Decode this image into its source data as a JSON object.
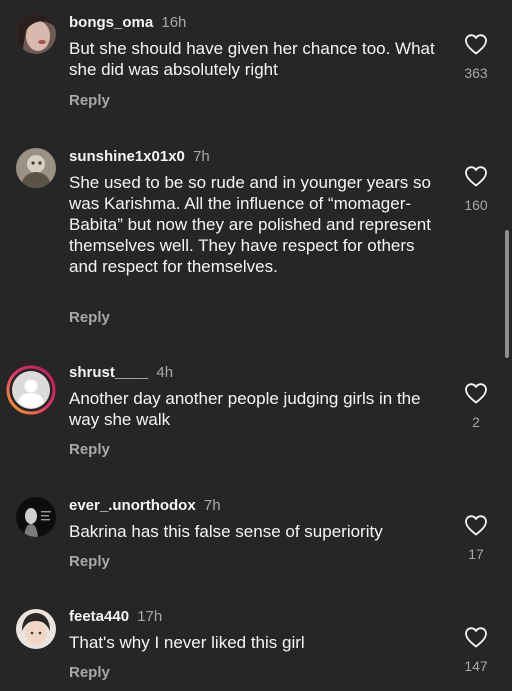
{
  "comments": [
    {
      "username": "bongs_oma",
      "time": "16h",
      "text": "But she should have given her chance too. What she did was absolutely right",
      "reply": "Reply",
      "likes": "363"
    },
    {
      "username": "sunshine1x01x0",
      "time": "7h",
      "text": "She used to be so rude and in younger years so was Karishma. All the influence of “momager- Babita” but now they are polished and represent themselves well. They have respect for others and respect for themselves.",
      "reply": "Reply",
      "likes": "160"
    },
    {
      "username": "shrust____",
      "time": "4h",
      "text": "Another day another people judging girls in the way she walk",
      "reply": "Reply",
      "likes": "2"
    },
    {
      "username": "ever_.unorthodox",
      "time": "7h",
      "text": "Bakrina has this false sense of superiority",
      "reply": "Reply",
      "likes": "17"
    },
    {
      "username": "feeta440",
      "time": "17h",
      "text": "That's why I never liked this girl",
      "reply": "Reply",
      "likes": "147"
    }
  ],
  "icons": {
    "like": "heart-outline-icon",
    "avatar_default": "default-avatar-icon"
  },
  "colors": {
    "background": "#262626",
    "text": "#f5f5f5",
    "secondary": "#a8a8a8",
    "story_ring_start": "#f9a825",
    "story_ring_end": "#c2185b"
  }
}
